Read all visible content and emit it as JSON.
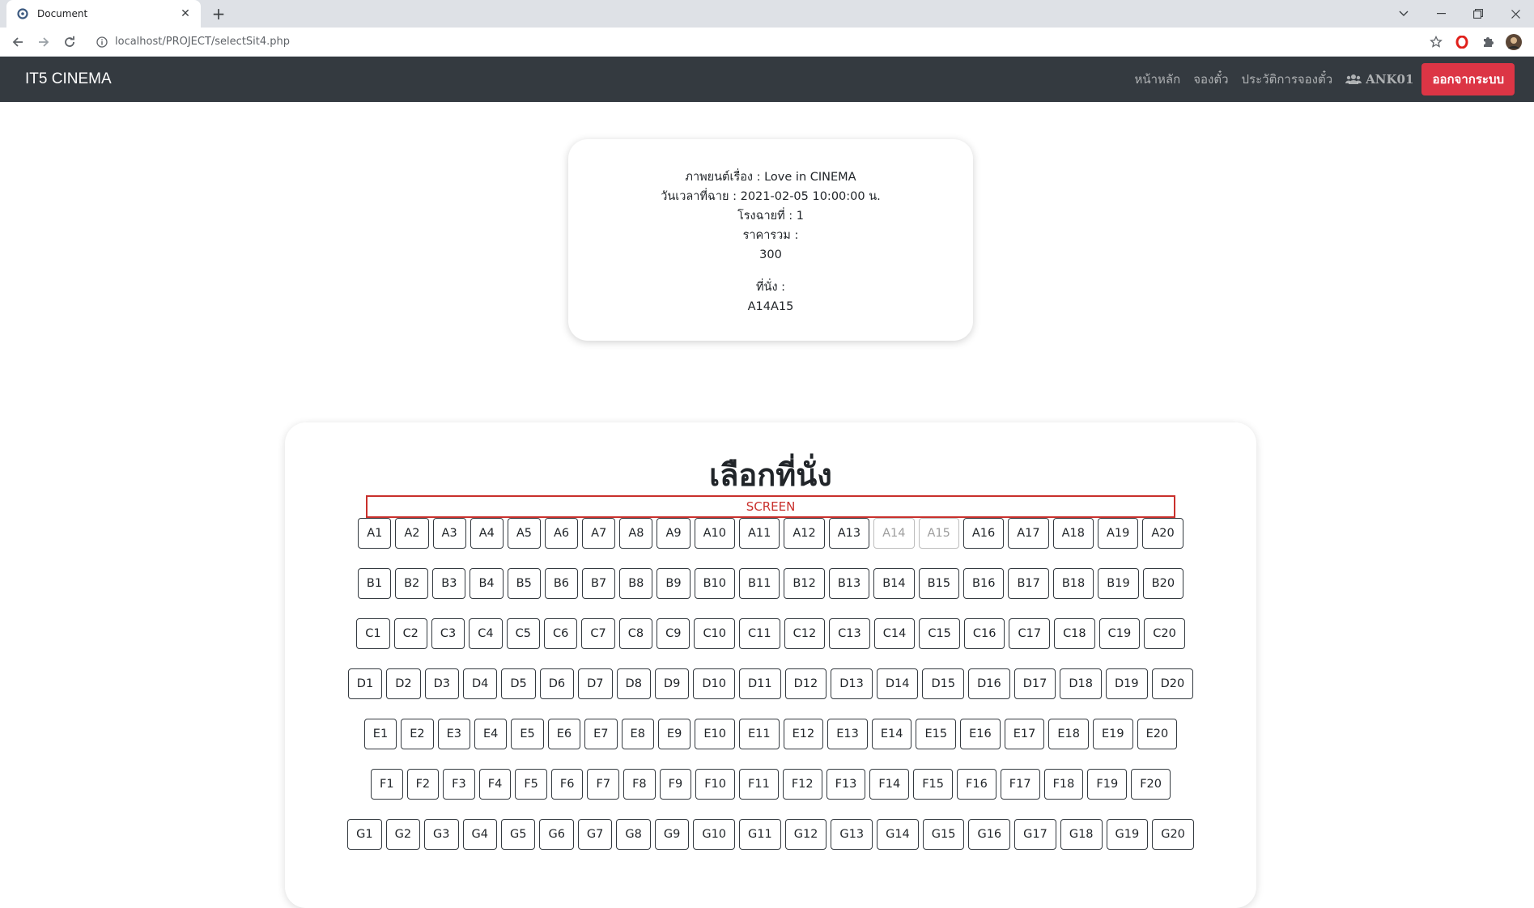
{
  "browser": {
    "tab_title": "Document",
    "url": "localhost/PROJECT/selectSit4.php"
  },
  "navbar": {
    "brand": "IT5 CINEMA",
    "links": [
      "หน้าหลัก",
      "จองตั๋ว",
      "ประวัติการจองตั๋ว"
    ],
    "user": "ANK01",
    "logout": "ออกจากระบบ",
    "bg_color": "#343a40",
    "logout_color": "#dc3545"
  },
  "info": {
    "movie": "ภาพยนต์เรื่อง : Love in CINEMA",
    "showtime": "วันเวลาที่ฉาย : 2021-02-05 10:00:00 น.",
    "theater": "โรงฉายที่ : 1",
    "total_label": "ราคารวม :",
    "total_value": "300",
    "seats_label": "ที่นั่ง :",
    "seats_value": "A14A15"
  },
  "seat_select": {
    "title": "เลือกที่นั่ง",
    "screen": "SCREEN",
    "rows": [
      "A",
      "B",
      "C",
      "D",
      "E",
      "F",
      "G"
    ],
    "seats_per_row": 20,
    "booked": [
      "A14",
      "A15"
    ]
  }
}
